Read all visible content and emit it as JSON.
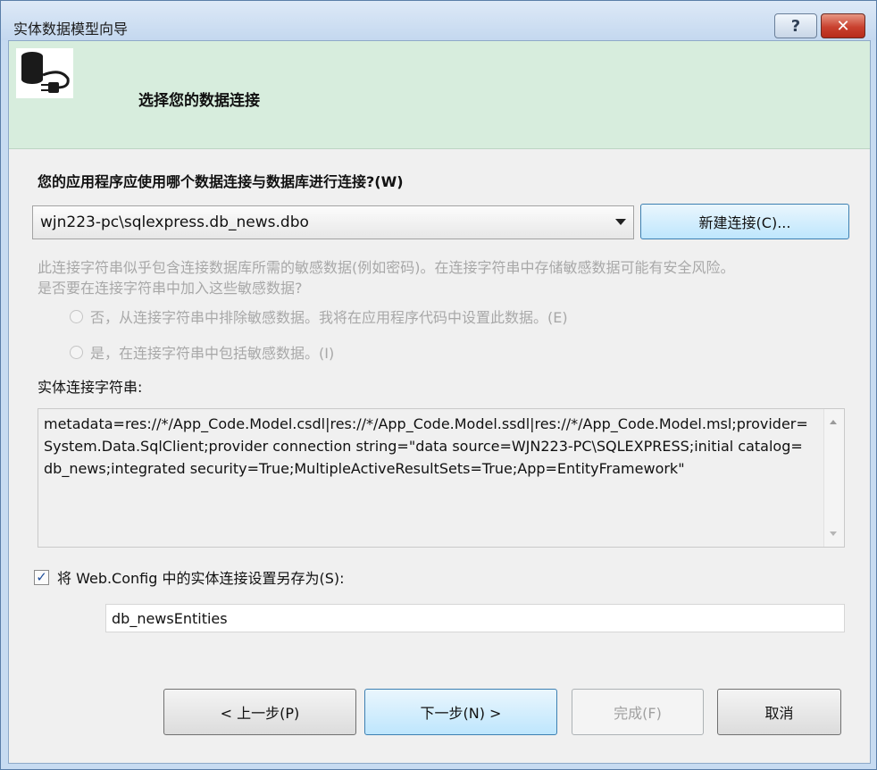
{
  "window": {
    "title": "实体数据模型向导",
    "help_label": "?",
    "close_label": "✕"
  },
  "banner": {
    "title": "选择您的数据连接",
    "icon": "database-plug-icon"
  },
  "connection": {
    "question": "您的应用程序应使用哪个数据连接与数据库进行连接?(W)",
    "selected": "wjn223-pc\\sqlexpress.db_news.dbo",
    "new_connection_label": "新建连接(C)..."
  },
  "sensitive": {
    "warning_line1": "此连接字符串似乎包含连接数据库所需的敏感数据(例如密码)。在连接字符串中存储敏感数据可能有安全风险。",
    "warning_line2": "是否要在连接字符串中加入这些敏感数据?",
    "option_exclude": "否，从连接字符串中排除敏感数据。我将在应用程序代码中设置此数据。(E)",
    "option_include": "是，在连接字符串中包括敏感数据。(I)"
  },
  "entity_connection": {
    "label": "实体连接字符串:",
    "value": "metadata=res://*/App_Code.Model.csdl|res://*/App_Code.Model.ssdl|res://*/App_Code.Model.msl;provider=System.Data.SqlClient;provider connection string=\"data source=WJN223-PC\\SQLEXPRESS;initial catalog=db_news;integrated security=True;MultipleActiveResultSets=True;App=EntityFramework\""
  },
  "save": {
    "checked": true,
    "check_mark": "✓",
    "label": "将 Web.Config 中的实体连接设置另存为(S):",
    "name_value": "db_newsEntities"
  },
  "buttons": {
    "back": "< 上一步(P)",
    "next": "下一步(N) >",
    "finish": "完成(F)",
    "cancel": "取消"
  }
}
